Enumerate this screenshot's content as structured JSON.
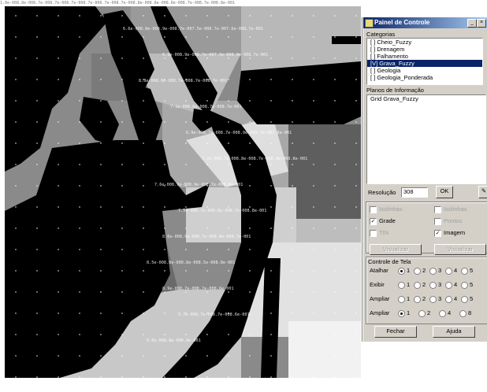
{
  "header_strip": {
    "text": "1.0e-008.8e-008.7e-008.7e-008.7e-008.7e-008.7e-008.7e-008.8e-008.8e-008.8e-008.7e-008.7e-008.8e-001"
  },
  "map": {
    "grid_labels": [
      "6.6e-008.8e-008.9e-008.7e-007.5e-008.7e-007.6e-008.7e-001",
      "6.9e-008.9e-008.7e-007.3e-008.9e-008.7e-001",
      "8.8e-008.8e-008.7e-008.7e-008.7e-001",
      "7.1e-008.6e-008.7e-008.7e-001",
      "6.9e-008.7e-008.7e-008.9e-008.7e-007.8e-001",
      "7.2e-008.7e-008.8e-008.7e-008.9e-008.8e-001",
      "7.6e-008.9e-008.9e-008.7e-008.8e-001",
      "7.5e-008.7e-008.8e-008.7e-008.8e-001",
      "8.6e-008.9e-008.7e-008.8e-008.7e-001",
      "8.5e-008.8e-008.8e-008.5e-008.8e-001",
      "8.9e-008.7e-008.7e-008.6e-001",
      "5.7e-008.7e-008.7e-008.6e-001",
      "9.0e-008.8e-008.8e-001"
    ]
  },
  "panel": {
    "title": "Painel de Controle",
    "categories_label": "Categorias",
    "categories": [
      "[ ] Cheio_Fuzzy",
      "[ ] Drenagem",
      "[ ] Falhamento",
      "[V] Grava_Fuzzy",
      "[ ] Geologia",
      "[ ] Geologia_Ponderada"
    ],
    "selected_index": 3,
    "planes_label": "Planos de Informação",
    "planes": [
      "Grid Grava_Fuzzy"
    ],
    "resolution_label": "Resolução",
    "resolution_value": "308",
    "ok_label": "OK",
    "checks": [
      {
        "label": "Isolinhas",
        "checked": false,
        "enabled": false
      },
      {
        "label": "Isolinhas",
        "checked": false,
        "enabled": false
      },
      {
        "label": "Grade",
        "checked": true,
        "enabled": true
      },
      {
        "label": "Pontos",
        "checked": false,
        "enabled": false
      },
      {
        "label": "TIN",
        "checked": false,
        "enabled": false
      },
      {
        "label": "Imagem",
        "checked": true,
        "enabled": true
      }
    ],
    "btn_left": "Visualizar",
    "btn_right": "Visualizar",
    "tela_label": "Controle de Tela",
    "rows": [
      {
        "label": "Atalhar",
        "opts": [
          "1",
          "2",
          "3",
          "4",
          "5"
        ]
      },
      {
        "label": "Exibir",
        "opts": [
          "1",
          "2",
          "3",
          "4",
          "5"
        ]
      },
      {
        "label": "Ampliar",
        "opts": [
          "1",
          "2",
          "3",
          "4",
          "5"
        ]
      },
      {
        "label": "Ampliar",
        "opts": [
          "1",
          "2",
          "4",
          "8"
        ]
      }
    ],
    "close_label": "Fechar",
    "help_label": "Ajuda"
  }
}
